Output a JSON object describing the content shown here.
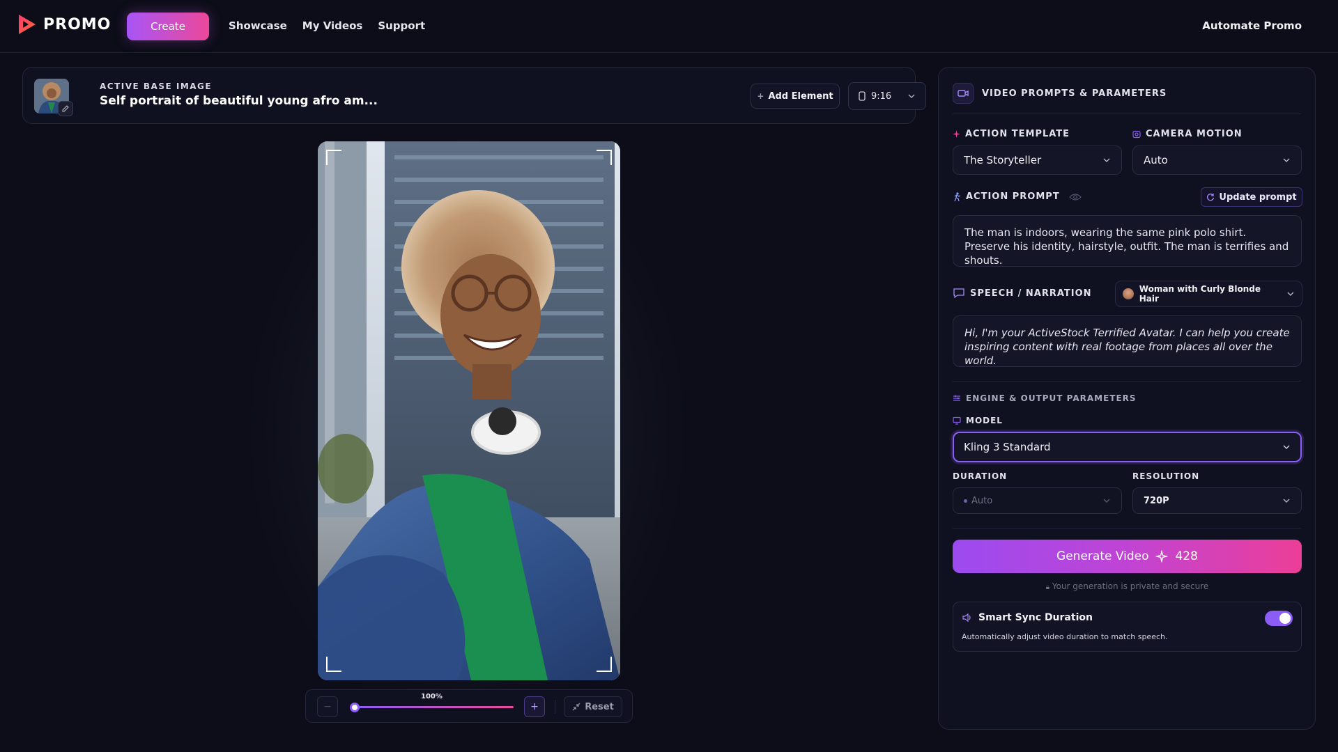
{
  "header": {
    "logo_text": "PROMO",
    "create_label": "Create",
    "nav": [
      "Showcase",
      "My Videos",
      "Support"
    ],
    "automate_label": "Automate Promo"
  },
  "base_image": {
    "label": "ACTIVE BASE IMAGE",
    "title": "Self portrait of beautiful young afro am...",
    "add_element_label": "Add Element",
    "aspect_ratio": "9:16"
  },
  "canvas": {
    "zoom_percent": "100%",
    "zoom_fraction": 0.0,
    "reset_label": "Reset"
  },
  "panel": {
    "title": "VIDEO PROMPTS & PARAMETERS",
    "action_template": {
      "label": "ACTION TEMPLATE",
      "value": "The Storyteller"
    },
    "camera_motion": {
      "label": "CAMERA MOTION",
      "value": "Auto"
    },
    "action_prompt": {
      "label": "ACTION PROMPT",
      "update_label": "Update prompt",
      "text": "The man is indoors, wearing the same pink polo shirt. Preserve his identity, hairstyle, outfit. The man is terrifies and shouts."
    },
    "speech": {
      "label": "SPEECH / NARRATION",
      "voice": "Woman with Curly Blonde Hair",
      "text": "Hi, I'm your ActiveStock Terrified Avatar. I can help you create inspiring content with real footage from places all over the world."
    },
    "engine_label": "ENGINE & OUTPUT PARAMETERS",
    "model": {
      "label": "MODEL",
      "value": "Kling 3 Standard"
    },
    "duration": {
      "label": "DURATION",
      "value": "Auto"
    },
    "resolution": {
      "label": "RESOLUTION",
      "value": "720P"
    },
    "generate": {
      "label": "Generate Video",
      "credits": "428"
    },
    "secure_note": "Your generation is private and secure",
    "smart_sync": {
      "title": "Smart Sync Duration",
      "description": "Automatically adjust video duration to match speech.",
      "enabled": true
    }
  },
  "colors": {
    "accent_purple": "#8b5cf6",
    "accent_pink": "#ec4899",
    "background": "#0c0d18"
  }
}
